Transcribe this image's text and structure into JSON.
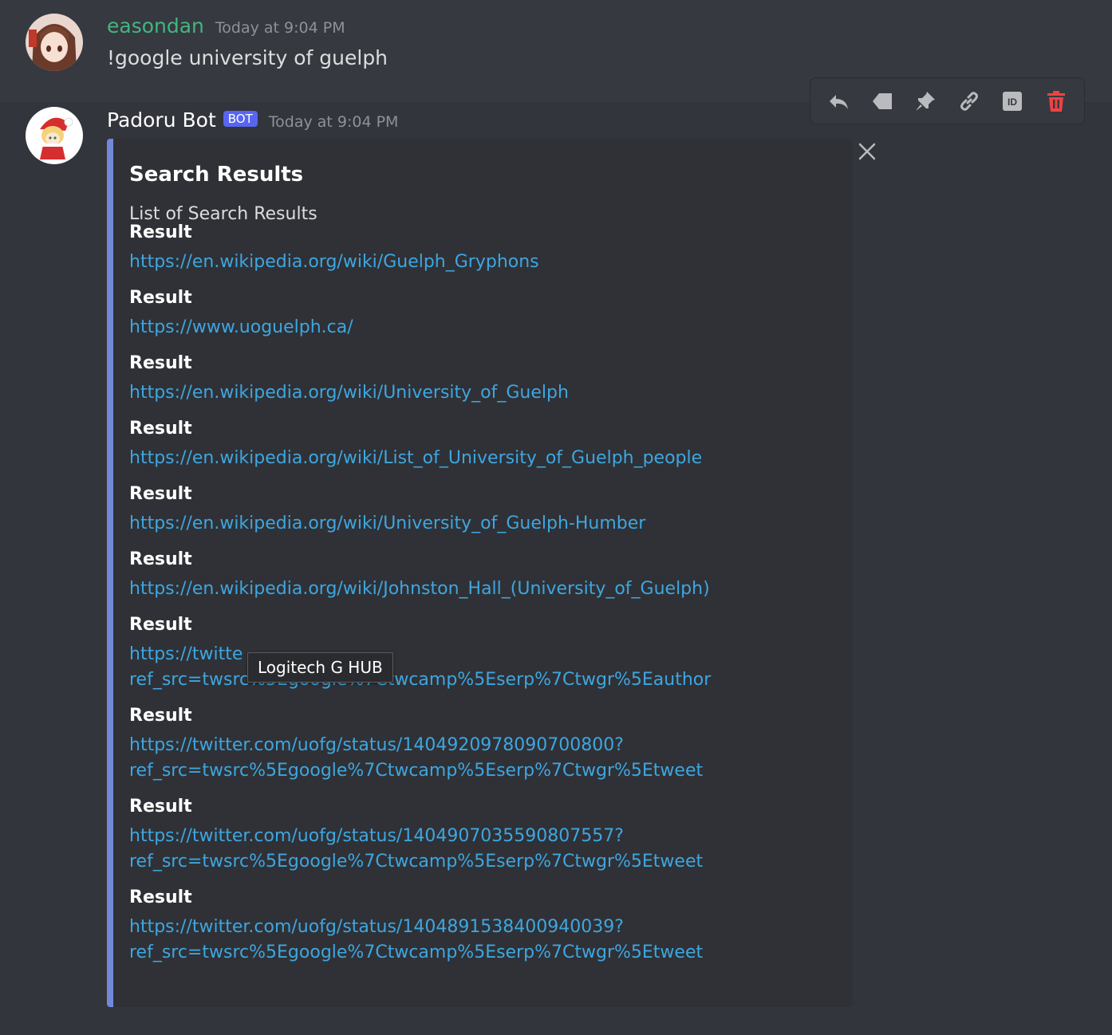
{
  "messages": [
    {
      "username": "easondan",
      "timestamp": "Today at 9:04 PM",
      "content": "!google university of guelph"
    },
    {
      "username": "Padoru Bot",
      "bot_tag": "BOT",
      "timestamp": "Today at 9:04 PM"
    }
  ],
  "toolbar": {
    "icons": [
      "reply-icon",
      "tag-icon",
      "pin-icon",
      "link-icon",
      "id-icon",
      "trash-icon"
    ],
    "id_label": "ID"
  },
  "embed": {
    "title": "Search Results",
    "description": "List of Search Results",
    "fields": [
      {
        "name": "Result",
        "lines": [
          "https://en.wikipedia.org/wiki/Guelph_Gryphons"
        ]
      },
      {
        "name": "Result",
        "lines": [
          "https://www.uoguelph.ca/"
        ]
      },
      {
        "name": "Result",
        "lines": [
          "https://en.wikipedia.org/wiki/University_of_Guelph"
        ]
      },
      {
        "name": "Result",
        "lines": [
          "https://en.wikipedia.org/wiki/List_of_University_of_Guelph_people"
        ]
      },
      {
        "name": "Result",
        "lines": [
          "https://en.wikipedia.org/wiki/University_of_Guelph-Humber"
        ]
      },
      {
        "name": "Result",
        "lines": [
          "https://en.wikipedia.org/wiki/Johnston_Hall_(University_of_Guelph)"
        ]
      },
      {
        "name": "Result",
        "lines": [
          "https://twitte",
          "ref_src=twsrc%5Egoogle%7Ctwcamp%5Eserp%7Ctwgr%5Eauthor"
        ]
      },
      {
        "name": "Result",
        "lines": [
          "https://twitter.com/uofg/status/1404920978090700800?",
          "ref_src=twsrc%5Egoogle%7Ctwcamp%5Eserp%7Ctwgr%5Etweet"
        ]
      },
      {
        "name": "Result",
        "lines": [
          "https://twitter.com/uofg/status/1404907035590807557?",
          "ref_src=twsrc%5Egoogle%7Ctwcamp%5Eserp%7Ctwgr%5Etweet"
        ]
      },
      {
        "name": "Result",
        "lines": [
          "https://twitter.com/uofg/status/1404891538400940039?",
          "ref_src=twsrc%5Egoogle%7Ctwcamp%5Eserp%7Ctwgr%5Etweet"
        ]
      }
    ]
  },
  "tooltip": "Logitech G HUB",
  "colors": {
    "background": "#36393f",
    "embed_background": "#2f3136",
    "embed_border": "#7289da",
    "link": "#00aff4",
    "username_green": "#43b581",
    "bot_tag": "#5865f2",
    "trash": "#ed4245"
  }
}
